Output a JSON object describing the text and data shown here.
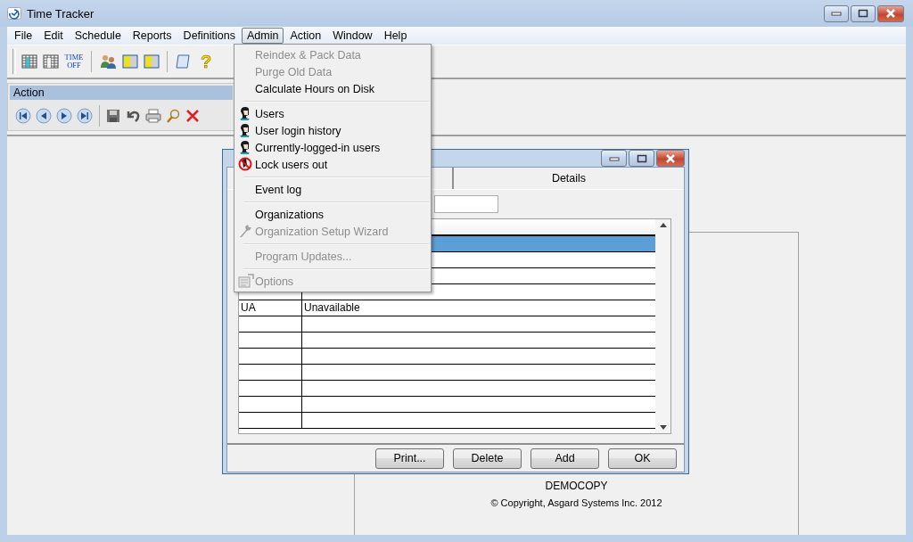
{
  "window": {
    "title": "Time Tracker"
  },
  "menubar": [
    {
      "label": "File",
      "selected": false
    },
    {
      "label": "Edit",
      "selected": false
    },
    {
      "label": "Schedule",
      "selected": false
    },
    {
      "label": "Reports",
      "selected": false
    },
    {
      "label": "Definitions",
      "selected": false
    },
    {
      "label": "Admin",
      "selected": true
    },
    {
      "label": "Action",
      "selected": false
    },
    {
      "label": "Window",
      "selected": false
    },
    {
      "label": "Help",
      "selected": false
    }
  ],
  "toolbar": {
    "time_off_label": [
      "TIME",
      "OFF"
    ],
    "help_glyph": "?"
  },
  "action_panel": {
    "title": "Action"
  },
  "form_panel": {
    "edition": "DEMOCOPY",
    "copyright": "© Copyright, Asgard Systems Inc. 2012"
  },
  "dialog": {
    "tabs": [
      {
        "label": "Details",
        "selected": false
      }
    ],
    "grid": {
      "rows": [
        {
          "selected": true
        },
        {
          "selected": false
        },
        {
          "selected": false
        },
        {
          "selected": false
        },
        {
          "code": "UA",
          "description": "Unavailable",
          "selected": false
        }
      ]
    },
    "buttons": [
      "Print...",
      "Delete",
      "Add",
      "OK"
    ]
  },
  "admin_menu": [
    {
      "kind": "item",
      "label": "Reindex & Pack Data",
      "disabled": true
    },
    {
      "kind": "item",
      "label": "Purge Old Data",
      "disabled": true
    },
    {
      "kind": "item",
      "label": "Calculate Hours on Disk",
      "disabled": false
    },
    {
      "kind": "separator"
    },
    {
      "kind": "user",
      "label": "Users",
      "disabled": false
    },
    {
      "kind": "user",
      "label": "User login history",
      "disabled": false
    },
    {
      "kind": "user",
      "label": "Currently-logged-in users",
      "disabled": false
    },
    {
      "kind": "lock",
      "label": "Lock users out",
      "disabled": false
    },
    {
      "kind": "separator"
    },
    {
      "kind": "item",
      "label": "Event log",
      "disabled": false
    },
    {
      "kind": "separator"
    },
    {
      "kind": "item",
      "label": "Organizations",
      "disabled": false
    },
    {
      "kind": "wizard",
      "label": "Organization Setup Wizard",
      "disabled": true
    },
    {
      "kind": "separator"
    },
    {
      "kind": "item",
      "label": "Program Updates...",
      "disabled": true
    },
    {
      "kind": "separator"
    },
    {
      "kind": "options",
      "label": "Options",
      "disabled": true
    }
  ]
}
